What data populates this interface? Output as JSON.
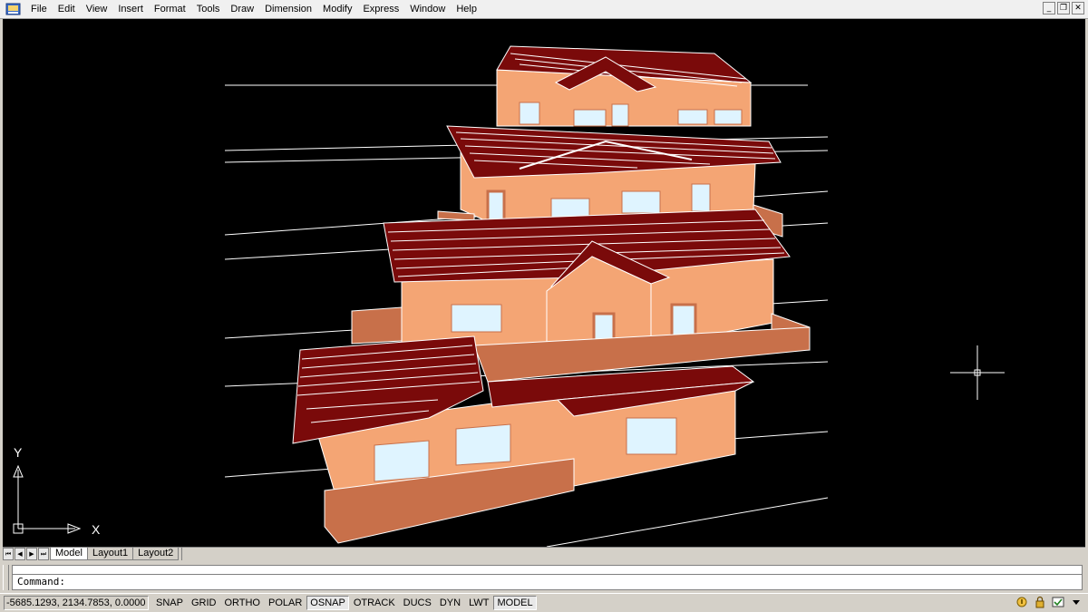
{
  "menu": {
    "items": [
      "File",
      "Edit",
      "View",
      "Insert",
      "Format",
      "Tools",
      "Draw",
      "Dimension",
      "Modify",
      "Express",
      "Window",
      "Help"
    ]
  },
  "window_controls": {
    "minimize": "_",
    "restore": "❐",
    "close": "✕"
  },
  "ucs": {
    "y_label": "Y",
    "x_label": "X"
  },
  "tabs": {
    "nav": [
      "⏮",
      "◀",
      "▶",
      "⏭"
    ],
    "items": [
      "Model",
      "Layout1",
      "Layout2"
    ],
    "active": "Model"
  },
  "command": {
    "prompt": "Command:"
  },
  "status": {
    "coords": "-5685.1293, 2134.7853, 0.0000",
    "toggles": [
      {
        "label": "SNAP",
        "on": false
      },
      {
        "label": "GRID",
        "on": false
      },
      {
        "label": "ORTHO",
        "on": false
      },
      {
        "label": "POLAR",
        "on": false
      },
      {
        "label": "OSNAP",
        "on": true
      },
      {
        "label": "OTRACK",
        "on": false
      },
      {
        "label": "DUCS",
        "on": false
      },
      {
        "label": "DYN",
        "on": false
      },
      {
        "label": "LWT",
        "on": false
      },
      {
        "label": "MODEL",
        "on": true
      }
    ]
  },
  "colors": {
    "background": "#000000",
    "wall": "#f4a574",
    "wall_shade": "#c8704a",
    "roof": "#7a0a0a",
    "roof_line": "#ffffff",
    "window": "#dff4ff"
  },
  "icons": [
    "autocad-app-icon",
    "communication-center-icon",
    "lock-icon",
    "tray-settings-icon",
    "chevron-down-icon"
  ]
}
